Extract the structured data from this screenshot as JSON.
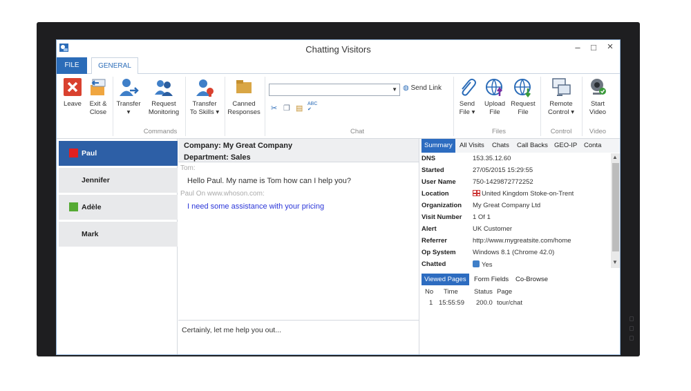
{
  "window": {
    "title": "Chatting Visitors",
    "minimize": "–",
    "maximize": "□",
    "close": "×"
  },
  "tabs": {
    "file": "FILE",
    "general": "GENERAL"
  },
  "ribbon": {
    "leave": "Leave",
    "exit_close_1": "Exit &",
    "exit_close_2": "Close",
    "transfer": "Transfer",
    "transfer_arrow": "▾",
    "request_monitoring_1": "Request",
    "request_monitoring_2": "Monitoring",
    "transfer_skills_1": "Transfer",
    "transfer_skills_2": "To Skills ▾",
    "canned_1": "Canned",
    "canned_2": "Responses",
    "group_commands": "Commands",
    "send_link": "Send Link",
    "group_chat": "Chat",
    "send_file_1": "Send",
    "send_file_2": "File ▾",
    "upload_file_1": "Upload",
    "upload_file_2": "File",
    "request_file_1": "Request",
    "request_file_2": "File",
    "group_files": "Files",
    "remote_control_1": "Remote",
    "remote_control_2": "Control ▾",
    "group_control": "Control",
    "start_video_1": "Start",
    "start_video_2": "Video",
    "group_video": "Video",
    "spell_label": "ABC"
  },
  "visitors": [
    {
      "name": "Paul",
      "color": "#e02020",
      "selected": true
    },
    {
      "name": "Jennifer",
      "color": "",
      "selected": false
    },
    {
      "name": "Adèle",
      "color": "#55aa33",
      "selected": false
    },
    {
      "name": "Mark",
      "color": "",
      "selected": false
    }
  ],
  "conversation": {
    "company": "Company: My Great Company",
    "department": "Department: Sales",
    "messages": [
      {
        "from": "Tom:",
        "text": "Hello Paul. My name is Tom how can I help you?",
        "color": "#333333"
      },
      {
        "from": "Paul On www.whoson.com:",
        "text": "I need some assistance with your pricing",
        "color": "#2a35d8"
      }
    ],
    "input_value": "Certainly, let me help you out..."
  },
  "details": {
    "tabs": [
      "Summary",
      "All Visits",
      "Chats",
      "Call Backs",
      "GEO-IP",
      "Conta"
    ],
    "rows": [
      {
        "key": "DNS",
        "value": "153.35.12.60"
      },
      {
        "key": "Started",
        "value": "27/05/2015 15:29:55"
      },
      {
        "key": "User Name",
        "value": "750-1429872772252"
      },
      {
        "key": "Location",
        "value": "United Kingdom Stoke-on-Trent"
      },
      {
        "key": "Organization",
        "value": "My Great Company Ltd"
      },
      {
        "key": "Visit Number",
        "value": "1 Of 1"
      },
      {
        "key": "Alert",
        "value": "UK Customer"
      },
      {
        "key": "Referrer",
        "value": "http://www.mygreatsite.com/home"
      },
      {
        "key": "Op System",
        "value": "Windows 8.1 (Chrome 42.0)"
      },
      {
        "key": "Chatted",
        "value": "Yes"
      }
    ],
    "bottom_tabs": [
      "Viewed Pages",
      "Form Fields",
      "Co-Browse"
    ],
    "pages_header": {
      "no": "No",
      "time": "Time",
      "status": "Status",
      "page": "Page"
    },
    "pages": [
      {
        "no": "1",
        "time": "15:55:59",
        "status": "200.0",
        "page": "tour/chat"
      }
    ]
  }
}
